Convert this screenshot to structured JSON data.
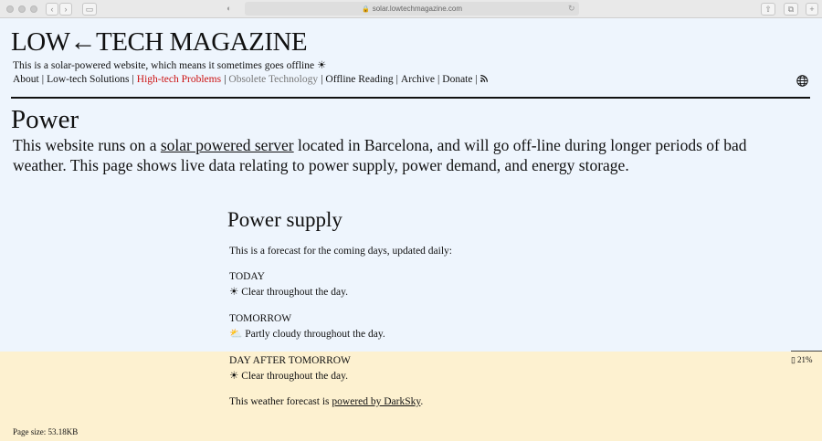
{
  "browser": {
    "url": "solar.lowtechmagazine.com"
  },
  "site": {
    "title": "LOW←TECH MAGAZINE",
    "tagline": "This is a solar-powered website, which means it sometimes goes offline ☀"
  },
  "nav": {
    "items": [
      {
        "label": "About"
      },
      {
        "label": "Low-tech Solutions"
      },
      {
        "label": "High-tech Problems"
      },
      {
        "label": "Obsolete Technology"
      },
      {
        "label": "Offline Reading"
      },
      {
        "label": "Archive"
      },
      {
        "label": "Donate"
      }
    ],
    "rss_icon": "rss-icon",
    "language_icon": "globe-icon",
    "colors": {
      "highlight": "#cc1111",
      "muted": "#777777"
    }
  },
  "page": {
    "title": "Power",
    "intro_before": "This website runs on a ",
    "intro_link": "solar powered server",
    "intro_after": " located in Barcelona, and will go off-line during longer periods of bad weather. This page shows live data relating to power supply, power demand, and energy storage."
  },
  "power_supply": {
    "heading": "Power supply",
    "description": "This is a forecast for the coming days, updated daily:",
    "forecast": [
      {
        "day": "TODAY",
        "icon": "☀",
        "condition": "Clear throughout the day."
      },
      {
        "day": "TOMORROW",
        "icon": "⛅",
        "condition": "Partly cloudy throughout the day."
      },
      {
        "day": "DAY AFTER TOMORROW",
        "icon": "☀",
        "condition": "Clear throughout the day."
      }
    ],
    "note_before": "This weather forecast is ",
    "note_link": "powered by DarkSky",
    "note_after": "."
  },
  "battery": {
    "label": "21%",
    "level_percent": 21,
    "icon": "battery-icon",
    "band_color": "#fdf1d0"
  },
  "footer": {
    "page_size": "Page size: 53.18KB"
  }
}
